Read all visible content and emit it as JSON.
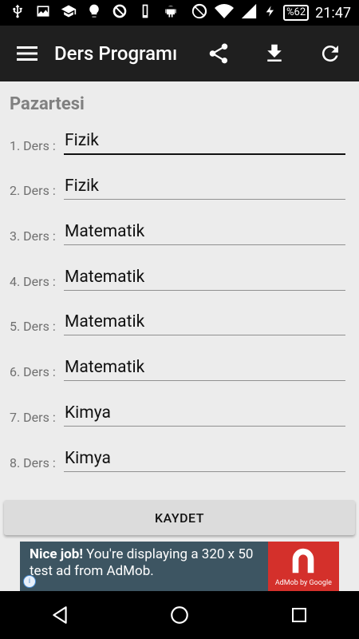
{
  "status_bar": {
    "battery": "%62",
    "time": "21:47"
  },
  "app_bar": {
    "title": "Ders Programı"
  },
  "day": "Pazartesi",
  "lessons": [
    {
      "label": "1. Ders :",
      "value": "Fizik"
    },
    {
      "label": "2. Ders :",
      "value": "Fizik"
    },
    {
      "label": "3. Ders :",
      "value": "Matematik"
    },
    {
      "label": "4. Ders :",
      "value": "Matematik"
    },
    {
      "label": "5. Ders :",
      "value": "Matematik"
    },
    {
      "label": "6. Ders :",
      "value": "Matematik"
    },
    {
      "label": "7. Ders :",
      "value": "Kimya"
    },
    {
      "label": "8. Ders :",
      "value": "Kimya"
    }
  ],
  "save_button": "KAYDET",
  "ad": {
    "headline": "Nice job!",
    "body": " You're displaying a 320 x 50 test ad from AdMob.",
    "logo_caption": "AdMob by Google",
    "info": "i"
  },
  "colors": {
    "app_bar": "#1f1f1f",
    "background": "#ececec",
    "ad_background": "#3d5562",
    "ad_logo": "#d4302b"
  }
}
